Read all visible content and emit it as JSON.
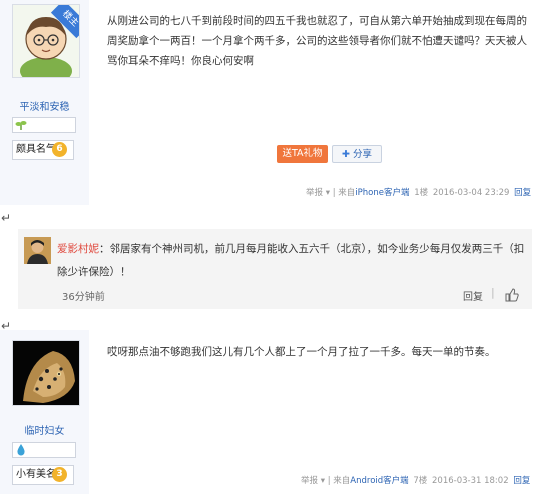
{
  "post1": {
    "username": "平淡和安稳",
    "level_title": "颇具名气",
    "level_num": "6",
    "corner_badge": "楼主",
    "content": "从刚进公司的七八千到前段时间的四五千我也就忍了，可自从第六单开始抽成到现在每周的周奖励拿个一两百！一个月拿个两千多，公司的这些领导者你们就不怕遭天谴吗？天天被人骂你耳朵不痒吗！你良心何安啊",
    "gift_label": "送TA礼物",
    "share_label": "分享",
    "meta": {
      "report": "举报",
      "sep1": "|",
      "from": "来自",
      "client": "iPhone客户端",
      "floor": "1楼",
      "time": "2016-03-04 23:29",
      "reply": "回复"
    }
  },
  "reply": {
    "username": "爱影村妮",
    "colon": "：",
    "text": "邻居家有个神州司机，前几月每月能收入五六千（北京），如今业务少每月仅发两三千（扣除少许保险）！",
    "time": "36分钟前",
    "reply_label": "回复",
    "sep": "|"
  },
  "post2": {
    "username": "临时妇女",
    "level_title": "小有美名",
    "level_num": "3",
    "content": "哎呀那点油不够跑我们这儿有几个人都上了一个月了拉了一千多。每天一单的节奏。",
    "meta": {
      "report": "举报",
      "sep1": "|",
      "from": "来自",
      "client": "Android客户端",
      "floor": "7楼",
      "time": "2016-03-31 18:02",
      "reply": "回复"
    }
  },
  "paragraph_mark": "↵",
  "colors": {
    "link": "#2d64b3",
    "gift": "#f0763c",
    "medal": "#f2b32b",
    "badge": "#3a7ad7"
  }
}
